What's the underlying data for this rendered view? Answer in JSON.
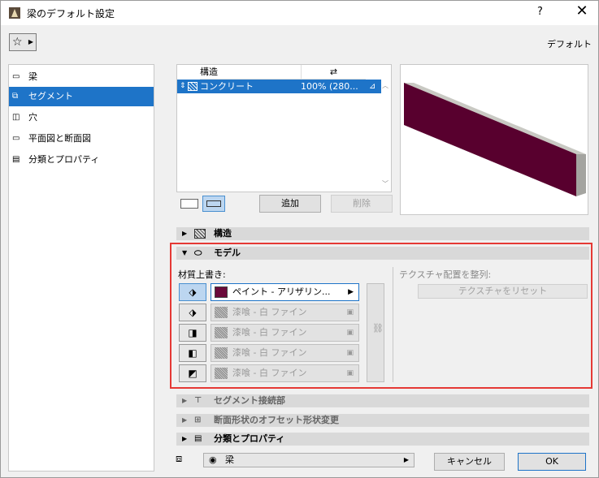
{
  "window": {
    "title": "梁のデフォルト設定",
    "help_label": "?",
    "close_label": "✕"
  },
  "header": {
    "favorites_icon": "star-icon",
    "favorites_symbol": "☆",
    "favorites_arrow": "▶",
    "default_label": "デフォルト"
  },
  "sidebar": {
    "items": [
      {
        "label": "梁",
        "icon": "beam-icon",
        "glyph": "▭",
        "selected": false
      },
      {
        "label": "セグメント",
        "icon": "segment-icon",
        "glyph": "⧉",
        "selected": true
      },
      {
        "label": "穴",
        "icon": "hole-icon",
        "glyph": "◫",
        "selected": false
      },
      {
        "label": "平面図と断面図",
        "icon": "plan-section-icon",
        "glyph": "▭",
        "selected": false
      },
      {
        "label": "分類とプロパティ",
        "icon": "properties-icon",
        "glyph": "▤",
        "selected": false
      }
    ]
  },
  "table": {
    "headers": [
      "構造",
      "⇄"
    ],
    "rows": [
      {
        "name": "コンクリート",
        "value": "100% (280...",
        "selected": true
      }
    ],
    "scroll_up": "︿",
    "scroll_down": "﹀"
  },
  "toolbar": {
    "add_label": "追加",
    "delete_label": "削除"
  },
  "colors": {
    "accent": "#1e74c8",
    "paint": "#6a0a3a",
    "beam_front": "#5a0030",
    "beam_side": "#a8a8a8",
    "highlight_box": "#e53935"
  },
  "sections": {
    "structure": "構造",
    "model": "モデル",
    "segment_joint": "セグメント接続部",
    "offset_shape": "断面形状のオフセット形状変更",
    "classification": "分類とプロパティ"
  },
  "model": {
    "override_label": "材質上書き:",
    "texture_align_label": "テクスチャ配置を整列:",
    "texture_reset_label": "テクスチャをリセット",
    "materials": [
      {
        "label": "ペイント - アリザリン...",
        "active": true
      },
      {
        "label": "漆喰 - 白 ファイン",
        "active": false
      },
      {
        "label": "漆喰 - 白 ファイン",
        "active": false
      },
      {
        "label": "漆喰 - 白 ファイン",
        "active": false
      },
      {
        "label": "漆喰 - 白 ファイン",
        "active": false
      }
    ]
  },
  "footer": {
    "layer_label": "梁",
    "cancel_label": "キャンセル",
    "ok_label": "OK"
  }
}
